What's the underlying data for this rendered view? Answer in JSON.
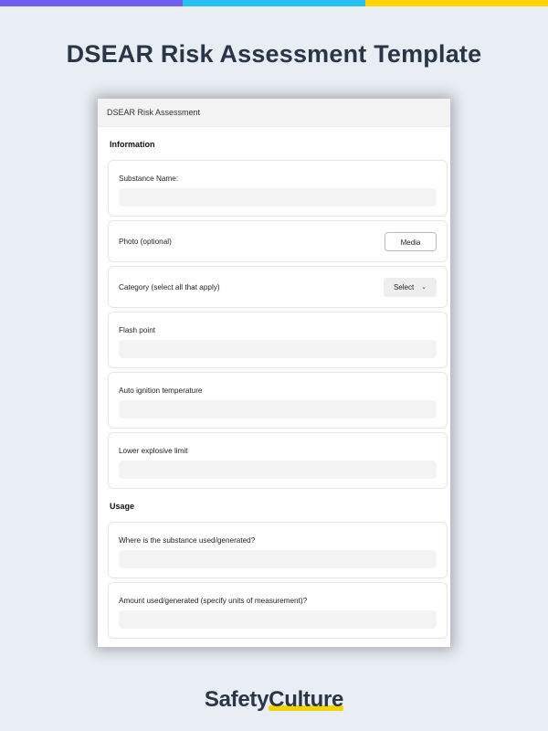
{
  "colors": {
    "strip": [
      "#6f5cf0",
      "#23c0f0",
      "#ffd400"
    ],
    "background": "#e9eef5",
    "title": "#2a3547",
    "logo_underline": "#f2d500"
  },
  "page": {
    "title": "DSEAR Risk Assessment Template"
  },
  "form": {
    "header": "DSEAR Risk Assessment",
    "sections": {
      "information": {
        "title": "Information",
        "substance_name": {
          "label": "Substance Name:"
        },
        "photo": {
          "label": "Photo (optional)",
          "button": "Media"
        },
        "category": {
          "label": "Category (select all that apply)",
          "select": "Select"
        },
        "flash_point": {
          "label": "Flash point"
        },
        "auto_ignition": {
          "label": "Auto ignition temperature"
        },
        "lower_explosive": {
          "label": "Lower explosive limit"
        }
      },
      "usage": {
        "title": "Usage",
        "where_used": {
          "label": "Where is the substance used/generated?"
        },
        "amount_used": {
          "label": "Amount used/generated (specify units of measurement)?"
        }
      }
    }
  },
  "logo": {
    "part1": "Safety",
    "part2": "Culture"
  },
  "icons": {
    "select_chevron": "chevron-down-icon"
  }
}
